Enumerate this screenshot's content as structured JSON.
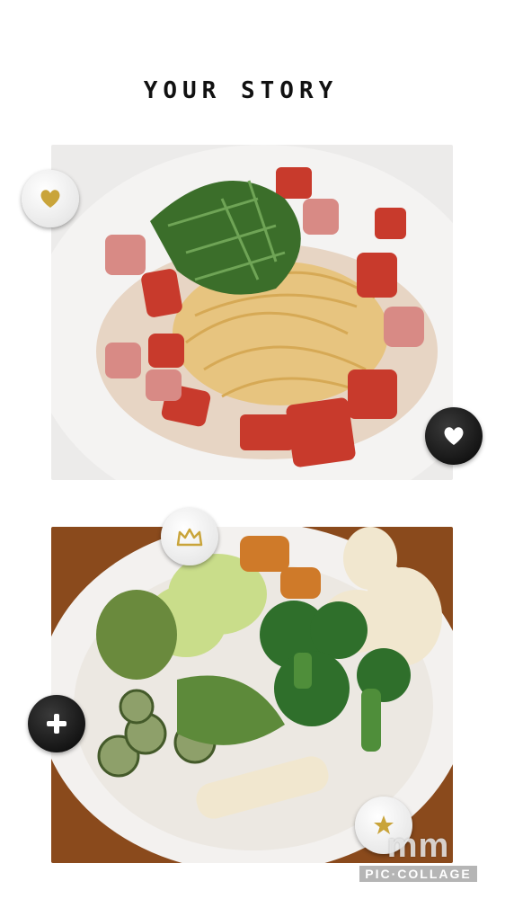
{
  "story": {
    "title": "YOUR STORY"
  },
  "photos": [
    {
      "subject": "pasta-with-tomato-and-herbs"
    },
    {
      "subject": "vegetable-salad-plate"
    }
  ],
  "badges": {
    "heart_gold": "heart-icon",
    "heart_white": "heart-icon",
    "crown": "crown-icon",
    "plus": "plus-icon",
    "star": "star-icon"
  },
  "watermark": {
    "mark": "mm",
    "text": "PIC·COLLAGE"
  },
  "colors": {
    "gold": "#c9a43a",
    "badge_black": "#151515",
    "badge_white": "#f2f2f2"
  }
}
